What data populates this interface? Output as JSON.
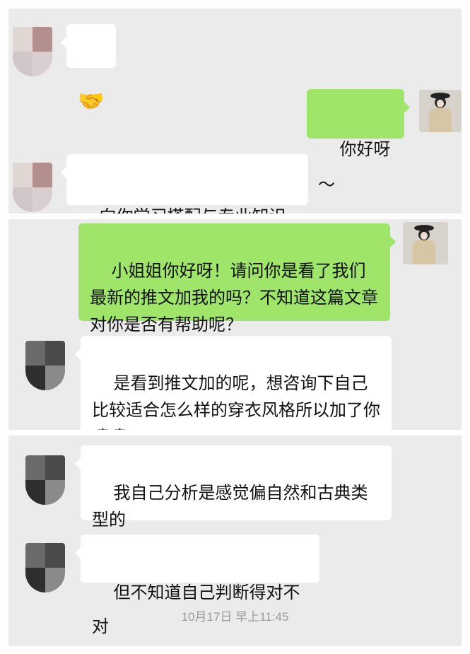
{
  "panels": [
    {
      "messages": [
        {
          "side": "in",
          "text": "🤝"
        },
        {
          "side": "out",
          "text": "你好呀～"
        },
        {
          "side": "in",
          "text": "向你学习搭配与专业知识"
        }
      ]
    },
    {
      "messages": [
        {
          "side": "out",
          "text": "小姐姐你好呀！请问你是看了我们最新的推文加我的吗？不知道这篇文章对你是否有帮助呢？"
        },
        {
          "side": "in",
          "text": "是看到推文加的呢，想咨询下自己比较适合怎么样的穿衣风格所以加了你嘻嘻▯"
        }
      ]
    },
    {
      "messages": [
        {
          "side": "in",
          "text": "我自己分析是感觉偏自然和古典类型的"
        },
        {
          "side": "in",
          "text": "但不知道自己判断得对不对"
        }
      ],
      "timestamp": "10月17日 早上11:45"
    }
  ],
  "colors": {
    "panel_bg": "#ebebeb",
    "bubble_out": "#9ee56a",
    "bubble_in": "#ffffff",
    "timestamp": "#9a9a9a"
  },
  "icons": [
    "handshake-emoji",
    "pixelated-avatar",
    "user-photo-avatar"
  ]
}
